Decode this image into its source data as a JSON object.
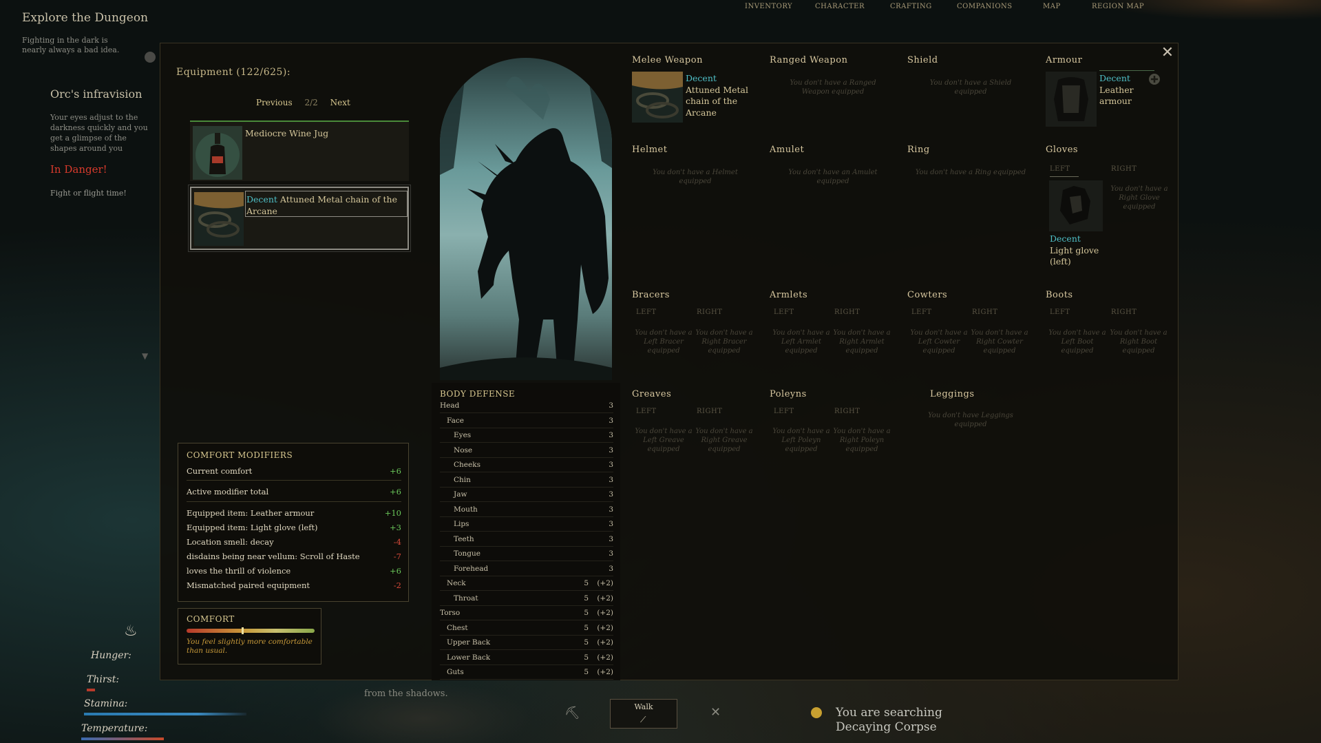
{
  "nav": {
    "items": [
      "Inventory",
      "Character",
      "Crafting",
      "Companions",
      "Map",
      "Region Map"
    ]
  },
  "quest": {
    "title": "Explore the Dungeon",
    "desc": "Fighting in the dark is nearly always a bad idea.",
    "orc_title": "Orc's infravision",
    "orc_desc": "Your eyes adjust to the darkness quickly and you get a glimpse of the shapes around you",
    "danger": "In Danger!",
    "fight": "Fight or flight time!"
  },
  "equipment": {
    "header": "Equipment (122/625):",
    "prev": "Previous",
    "page": "2/2",
    "next": "Next",
    "items": [
      {
        "quality": "",
        "name": "Mediocre Wine Jug"
      },
      {
        "quality": "Decent",
        "name": "Attuned Metal chain of the Arcane"
      }
    ]
  },
  "comfort_modifiers": {
    "title": "COMFORT MODIFIERS",
    "rows": [
      {
        "label": "Current comfort",
        "value": "+6"
      },
      {
        "label": "Active modifier total",
        "value": "+6"
      },
      {
        "label": "Equipped item: Leather armour",
        "value": "+10"
      },
      {
        "label": "Equipped item: Light glove (left)",
        "value": "+3"
      },
      {
        "label": "Location smell: decay",
        "value": "-4"
      },
      {
        "label": "disdains being near vellum: Scroll of Haste",
        "value": "-7"
      },
      {
        "label": "loves the thrill of violence",
        "value": "+6"
      },
      {
        "label": "Mismatched paired equipment",
        "value": "-2"
      }
    ]
  },
  "comfort": {
    "title": "COMFORT",
    "level": 0.43,
    "desc": "You feel slightly more comfortable than usual."
  },
  "body_defense": {
    "title": "BODY DEFENSE",
    "rows": [
      {
        "name": "Head",
        "indent": 0,
        "value": "3",
        "bonus": ""
      },
      {
        "name": "Face",
        "indent": 1,
        "value": "3",
        "bonus": ""
      },
      {
        "name": "Eyes",
        "indent": 2,
        "value": "3",
        "bonus": ""
      },
      {
        "name": "Nose",
        "indent": 2,
        "value": "3",
        "bonus": ""
      },
      {
        "name": "Cheeks",
        "indent": 2,
        "value": "3",
        "bonus": ""
      },
      {
        "name": "Chin",
        "indent": 2,
        "value": "3",
        "bonus": ""
      },
      {
        "name": "Jaw",
        "indent": 2,
        "value": "3",
        "bonus": ""
      },
      {
        "name": "Mouth",
        "indent": 2,
        "value": "3",
        "bonus": ""
      },
      {
        "name": "Lips",
        "indent": 2,
        "value": "3",
        "bonus": ""
      },
      {
        "name": "Teeth",
        "indent": 2,
        "value": "3",
        "bonus": ""
      },
      {
        "name": "Tongue",
        "indent": 2,
        "value": "3",
        "bonus": ""
      },
      {
        "name": "Forehead",
        "indent": 2,
        "value": "3",
        "bonus": ""
      },
      {
        "name": "Neck",
        "indent": 1,
        "value": "5",
        "bonus": "(+2)"
      },
      {
        "name": "Throat",
        "indent": 2,
        "value": "5",
        "bonus": "(+2)"
      },
      {
        "name": "Torso",
        "indent": 0,
        "value": "5",
        "bonus": "(+2)"
      },
      {
        "name": "Chest",
        "indent": 1,
        "value": "5",
        "bonus": "(+2)"
      },
      {
        "name": "Upper Back",
        "indent": 1,
        "value": "5",
        "bonus": "(+2)"
      },
      {
        "name": "Lower Back",
        "indent": 1,
        "value": "5",
        "bonus": "(+2)"
      },
      {
        "name": "Guts",
        "indent": 1,
        "value": "5",
        "bonus": "(+2)"
      }
    ]
  },
  "slots": {
    "left_label": "LEFT",
    "right_label": "RIGHT",
    "melee": {
      "title": "Melee Weapon",
      "quality": "Decent",
      "name": "Attuned Metal chain of the Arcane"
    },
    "ranged": {
      "title": "Ranged Weapon",
      "empty": "You don't have a Ranged Weapon equipped"
    },
    "shield": {
      "title": "Shield",
      "empty": "You don't have a Shield equipped"
    },
    "armour": {
      "title": "Armour",
      "quality": "Decent",
      "name": "Leather armour"
    },
    "helmet": {
      "title": "Helmet",
      "empty": "You don't have a Helmet equipped"
    },
    "amulet": {
      "title": "Amulet",
      "empty": "You don't have an Amulet equipped"
    },
    "ring": {
      "title": "Ring",
      "empty": "You don't have a Ring equipped"
    },
    "gloves": {
      "title": "Gloves",
      "quality": "Decent",
      "name": "Light glove (left)",
      "right_empty": "You don't have a Right Glove equipped"
    },
    "bracers": {
      "title": "Bracers",
      "left_empty": "You don't have a Left Bracer equipped",
      "right_empty": "You don't have a Right Bracer equipped"
    },
    "armlets": {
      "title": "Armlets",
      "left_empty": "You don't have a Left Armlet equipped",
      "right_empty": "You don't have a Right Armlet equipped"
    },
    "cowters": {
      "title": "Cowters",
      "left_empty": "You don't have a Left Cowter equipped",
      "right_empty": "You don't have a Right Cowter equipped"
    },
    "boots": {
      "title": "Boots",
      "left_empty": "You don't have a Left Boot equipped",
      "right_empty": "You don't have a Right Boot equipped"
    },
    "greaves": {
      "title": "Greaves",
      "left_empty": "You don't have a Left Greave equipped",
      "right_empty": "You don't have a Right Greave equipped"
    },
    "poleyns": {
      "title": "Poleyns",
      "left_empty": "You don't have a Left Poleyn equipped",
      "right_empty": "You don't have a Right Poleyn equipped"
    },
    "leggings": {
      "title": "Leggings",
      "empty": "You don't have Leggings equipped"
    }
  },
  "hud": {
    "hunger": "Hunger:",
    "thirst": "Thirst:",
    "stamina": "Stamina:",
    "temperature": "Temperature:",
    "shadow_text": "from the shadows.",
    "walk": "Walk",
    "search_line1": "You are searching",
    "search_line2": "Decaying Corpse",
    "colors": {
      "stamina": "#2a7ab0",
      "temperature": "#c84a2a",
      "thirst": "#b83a2a"
    }
  }
}
